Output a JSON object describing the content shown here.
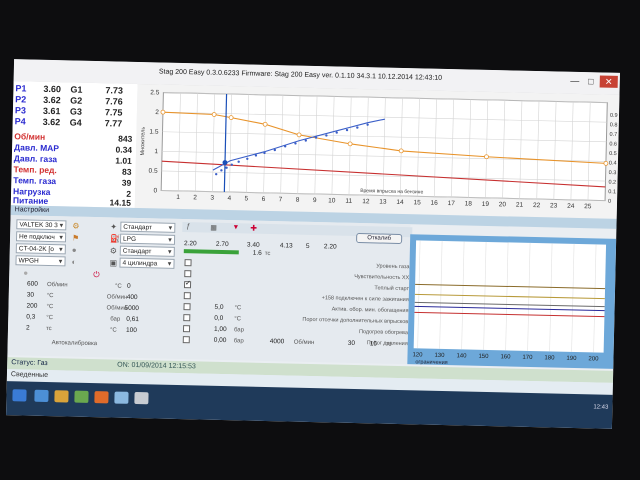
{
  "window": {
    "title": "Stag 200 Easy 0.3.0.6233 Firmware: Stag 200 Easy  ver. 0.1.10  34.3.1   10.12.2014 12:43:10",
    "minimize": "—",
    "maximize": "□",
    "close": "✕"
  },
  "injectors": [
    {
      "label": "P1",
      "value": "3.60",
      "gas_label": "G1",
      "gas_value": "7.73"
    },
    {
      "label": "P2",
      "value": "3.62",
      "gas_label": "G2",
      "gas_value": "7.76"
    },
    {
      "label": "P3",
      "value": "3.61",
      "gas_label": "G3",
      "gas_value": "7.75"
    },
    {
      "label": "P4",
      "value": "3.62",
      "gas_label": "G4",
      "gas_value": "7.77"
    }
  ],
  "metrics": [
    {
      "label": "Об/мин",
      "value": "843",
      "highlight": true
    },
    {
      "label": "Давл. MAP",
      "value": "0.34",
      "highlight": false
    },
    {
      "label": "Давл. газа",
      "value": "1.01",
      "highlight": false
    },
    {
      "label": "Темп. ред.",
      "value": "83",
      "highlight": true
    },
    {
      "label": "Темп. газа",
      "value": "39",
      "highlight": false
    },
    {
      "label": "Нагрузка",
      "value": "2",
      "highlight": false
    },
    {
      "label": "Питание",
      "value": "14.15",
      "highlight": false
    }
  ],
  "chart_data": {
    "type": "line",
    "xlabel": "Время впрыска на бензине",
    "ylabel": "Множитель",
    "xlim": [
      0,
      26
    ],
    "ylim": [
      0,
      2.5
    ],
    "x_ticks": [
      1,
      2,
      3,
      4,
      5,
      6,
      7,
      8,
      9,
      10,
      11,
      12,
      13,
      14,
      15,
      16,
      17,
      18,
      19,
      20,
      21,
      22,
      23,
      24,
      25
    ],
    "y_ticks": [
      0,
      0.5,
      1,
      1.5,
      2,
      2.5
    ],
    "y2_ticks": [
      0,
      0.1,
      0.2,
      0.3,
      0.4,
      0.5,
      0.6,
      0.7,
      0.8,
      0.9
    ],
    "grid": true,
    "cursor_x": 3.7,
    "series": [
      {
        "color": "#e8932a",
        "x": [
          0,
          3,
          4,
          6,
          8,
          11,
          14,
          19,
          26
        ],
        "y": [
          2.0,
          1.97,
          1.9,
          1.75,
          1.5,
          1.3,
          1.15,
          1.05,
          0.95
        ]
      },
      {
        "color": "#c73030",
        "x": [
          0,
          26
        ],
        "y": [
          0.75,
          0.35
        ]
      },
      {
        "color": "#3b5fc8",
        "x": [
          3.0,
          4.0,
          6.0,
          8.0,
          10.0,
          12.0,
          13.0
        ],
        "y": [
          0.55,
          0.8,
          1.05,
          1.35,
          1.6,
          1.85,
          1.95
        ]
      }
    ],
    "scatter_points": {
      "color": "#3b5fc8",
      "x": [
        3.2,
        3.5,
        3.8,
        4.1,
        4.5,
        5.0,
        5.5,
        6.0,
        6.6,
        7.2,
        7.8,
        8.4,
        9.0,
        9.6,
        10.2,
        10.8,
        11.4,
        12.0
      ],
      "y": [
        0.45,
        0.55,
        0.62,
        0.7,
        0.78,
        0.86,
        0.95,
        1.02,
        1.1,
        1.2,
        1.28,
        1.36,
        1.44,
        1.5,
        1.58,
        1.65,
        1.72,
        1.8
      ]
    }
  },
  "settings": {
    "tab_label": "Настройки",
    "selects_left": [
      "VALTEK 30 3",
      "Не подключ",
      "CT-04-2K [o",
      "WPGH"
    ],
    "selects_mid": [
      "Стандарт",
      "LPG",
      "Стандарт",
      "4 цилиндра"
    ],
    "mid_values": [
      "2.20",
      "2.70",
      "3.40",
      "4.13",
      "5",
      "2.20"
    ],
    "mid_values2": [
      "1.6",
      "тс"
    ],
    "left_params": [
      {
        "value": "600",
        "unit": "Об/мин",
        "value2": "0",
        "unit2": "°C"
      },
      {
        "value": "30",
        "unit": "°C",
        "value2": "400",
        "unit2": "Об/мин"
      },
      {
        "value": "200",
        "unit": "°C",
        "value2": "5000",
        "unit2": "Об/мин"
      },
      {
        "value": "0,3",
        "unit": "°C",
        "value2": "0,61",
        "unit2": "бар"
      },
      {
        "value": "2",
        "unit": "тс",
        "value2": "100",
        "unit2": "°C"
      }
    ],
    "calibrate_button": "Откалиб",
    "calibrate_label": "Автокалибровка",
    "checkbox_rows": [
      {
        "label": "Уровень газа",
        "checked": false
      },
      {
        "label": "Чувствительность ХХ",
        "checked": false
      },
      {
        "label": "Теплый старт",
        "checked": true
      },
      {
        "label": "+158 подключен к силе зажигания",
        "checked": false
      },
      {
        "label": "Актив. обор. мин. обогащения",
        "checked": false
      },
      {
        "label": "Порог отсечки дополнительных впрысков",
        "checked": false
      },
      {
        "label": "Подогрев обогрева",
        "checked": false
      },
      {
        "label": "Порог давления",
        "checked": false
      }
    ],
    "row_values": [
      "5,0",
      "°C",
      "0,0",
      "°C",
      "1,00",
      "бар",
      "0,00",
      "бар",
      "4000",
      "Об/мин",
      "30",
      "15",
      "тс"
    ]
  },
  "right_chart": {
    "x_ticks": [
      "120",
      "130",
      "140",
      "150",
      "160",
      "170",
      "180",
      "190",
      "200"
    ],
    "footer": "ограничения"
  },
  "status": {
    "label": "Статус: Газ",
    "value": "ON: 01/09/2014 12:15:53",
    "lower": "Сведенные"
  },
  "taskbar": {
    "clock": "12:43"
  },
  "colors": {
    "accent": "#2a2ad0",
    "alert": "#d23030",
    "chart_bg": "#f3f3f3",
    "panel_bg": "#bcd3e4"
  }
}
